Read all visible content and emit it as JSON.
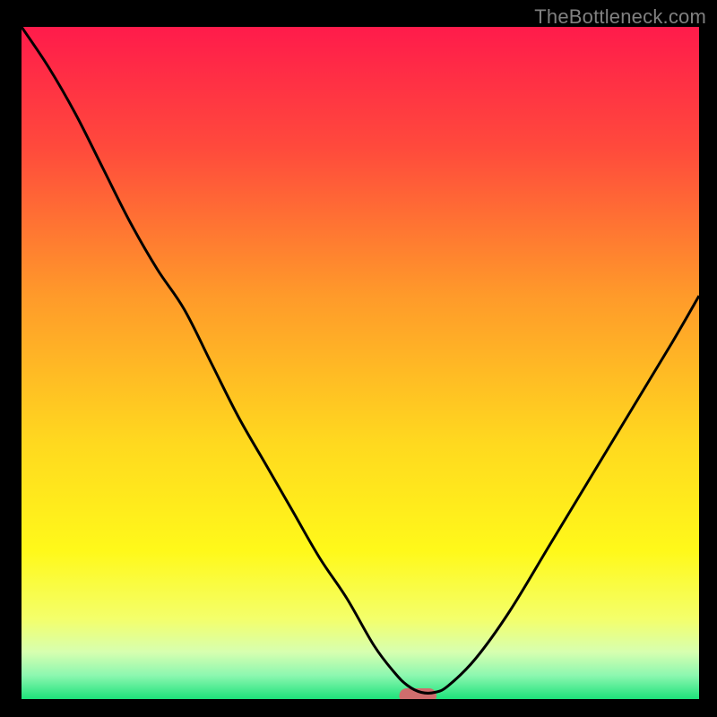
{
  "watermark": "TheBottleneck.com",
  "chart_data": {
    "type": "line",
    "title": "",
    "xlabel": "",
    "ylabel": "",
    "xlim": [
      0,
      100
    ],
    "ylim": [
      0,
      100
    ],
    "grid": false,
    "legend": false,
    "gradient_stops": [
      {
        "offset": 0,
        "color": "#ff1b4b"
      },
      {
        "offset": 0.18,
        "color": "#ff4a3c"
      },
      {
        "offset": 0.4,
        "color": "#ff9a2a"
      },
      {
        "offset": 0.62,
        "color": "#ffd91f"
      },
      {
        "offset": 0.78,
        "color": "#fff91a"
      },
      {
        "offset": 0.88,
        "color": "#f4ff6a"
      },
      {
        "offset": 0.93,
        "color": "#d7ffb0"
      },
      {
        "offset": 0.965,
        "color": "#8cf7b0"
      },
      {
        "offset": 1.0,
        "color": "#1de27a"
      }
    ],
    "series": [
      {
        "name": "bottleneck-curve",
        "x": [
          0,
          4,
          8,
          12,
          16,
          20,
          24,
          28,
          32,
          36,
          40,
          44,
          48,
          52,
          55,
          57,
          59,
          61,
          63,
          67,
          72,
          78,
          84,
          90,
          96,
          100
        ],
        "y": [
          100,
          94,
          87,
          79,
          71,
          64,
          58,
          50,
          42,
          35,
          28,
          21,
          15,
          8,
          4,
          2,
          1,
          1,
          2,
          6,
          13,
          23,
          33,
          43,
          53,
          60
        ]
      }
    ],
    "marker": {
      "x": 58.5,
      "y": 0.5,
      "width": 5.5,
      "height": 2.2,
      "color": "#cf6d6d",
      "rx": 1.1
    }
  }
}
